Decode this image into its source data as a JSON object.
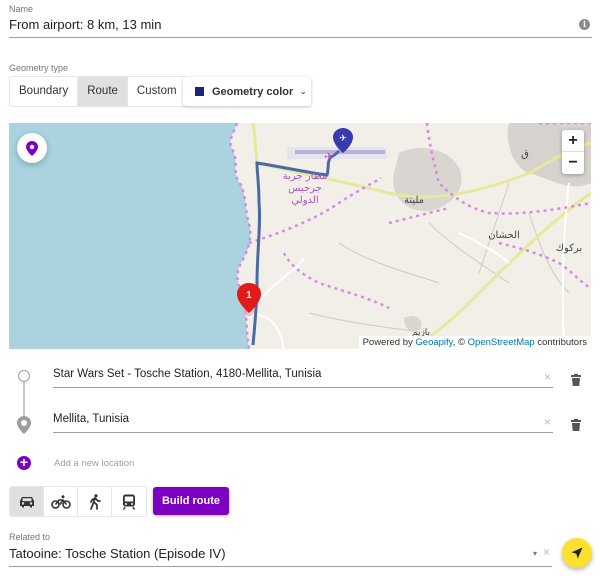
{
  "name_field": {
    "label": "Name",
    "value": "From airport: 8 km, 13 min",
    "info_icon": "info-icon"
  },
  "geometry": {
    "label": "Geometry type",
    "options": [
      "Boundary",
      "Route",
      "Custom"
    ],
    "selected": "Route",
    "color_button_label": "Geometry color",
    "color": "#1a237e"
  },
  "map": {
    "zoom_in": "+",
    "zoom_out": "−",
    "attribution_prefix": "Powered by ",
    "attribution_geoapify": "Geoapify",
    "attribution_sep": ", © ",
    "attribution_osm": "OpenStreetMap",
    "attribution_suffix": " contributors",
    "marker_label": "1",
    "places": [
      "مطار جربة جرجيس الدولي",
      "مليتة",
      "الحشان",
      "بركوك",
      "بازيم"
    ],
    "route_color": "#4a6aa5",
    "marker_color": "#e11b1b"
  },
  "waypoints": [
    {
      "value": "Star Wars Set - Tosche Station, 4180-Mellita, Tunisia",
      "clear": "×"
    },
    {
      "value": "Mellita, Tunisia",
      "clear": "×"
    }
  ],
  "add_location_label": "Add a new location",
  "travel_modes": [
    {
      "icon": "car-icon",
      "active": true
    },
    {
      "icon": "bicycle-icon",
      "active": false
    },
    {
      "icon": "walk-icon",
      "active": false
    },
    {
      "icon": "train-icon",
      "active": false
    }
  ],
  "build_route_label": "Build route",
  "accent_color": "#7b00c2",
  "related": {
    "label": "Related to",
    "value": "Tatooine: Tosche Station (Episode IV)",
    "clear": "×",
    "caret": "▾"
  },
  "fab_icon": "navigation-arrow-icon",
  "fab_color": "#fbe12d"
}
